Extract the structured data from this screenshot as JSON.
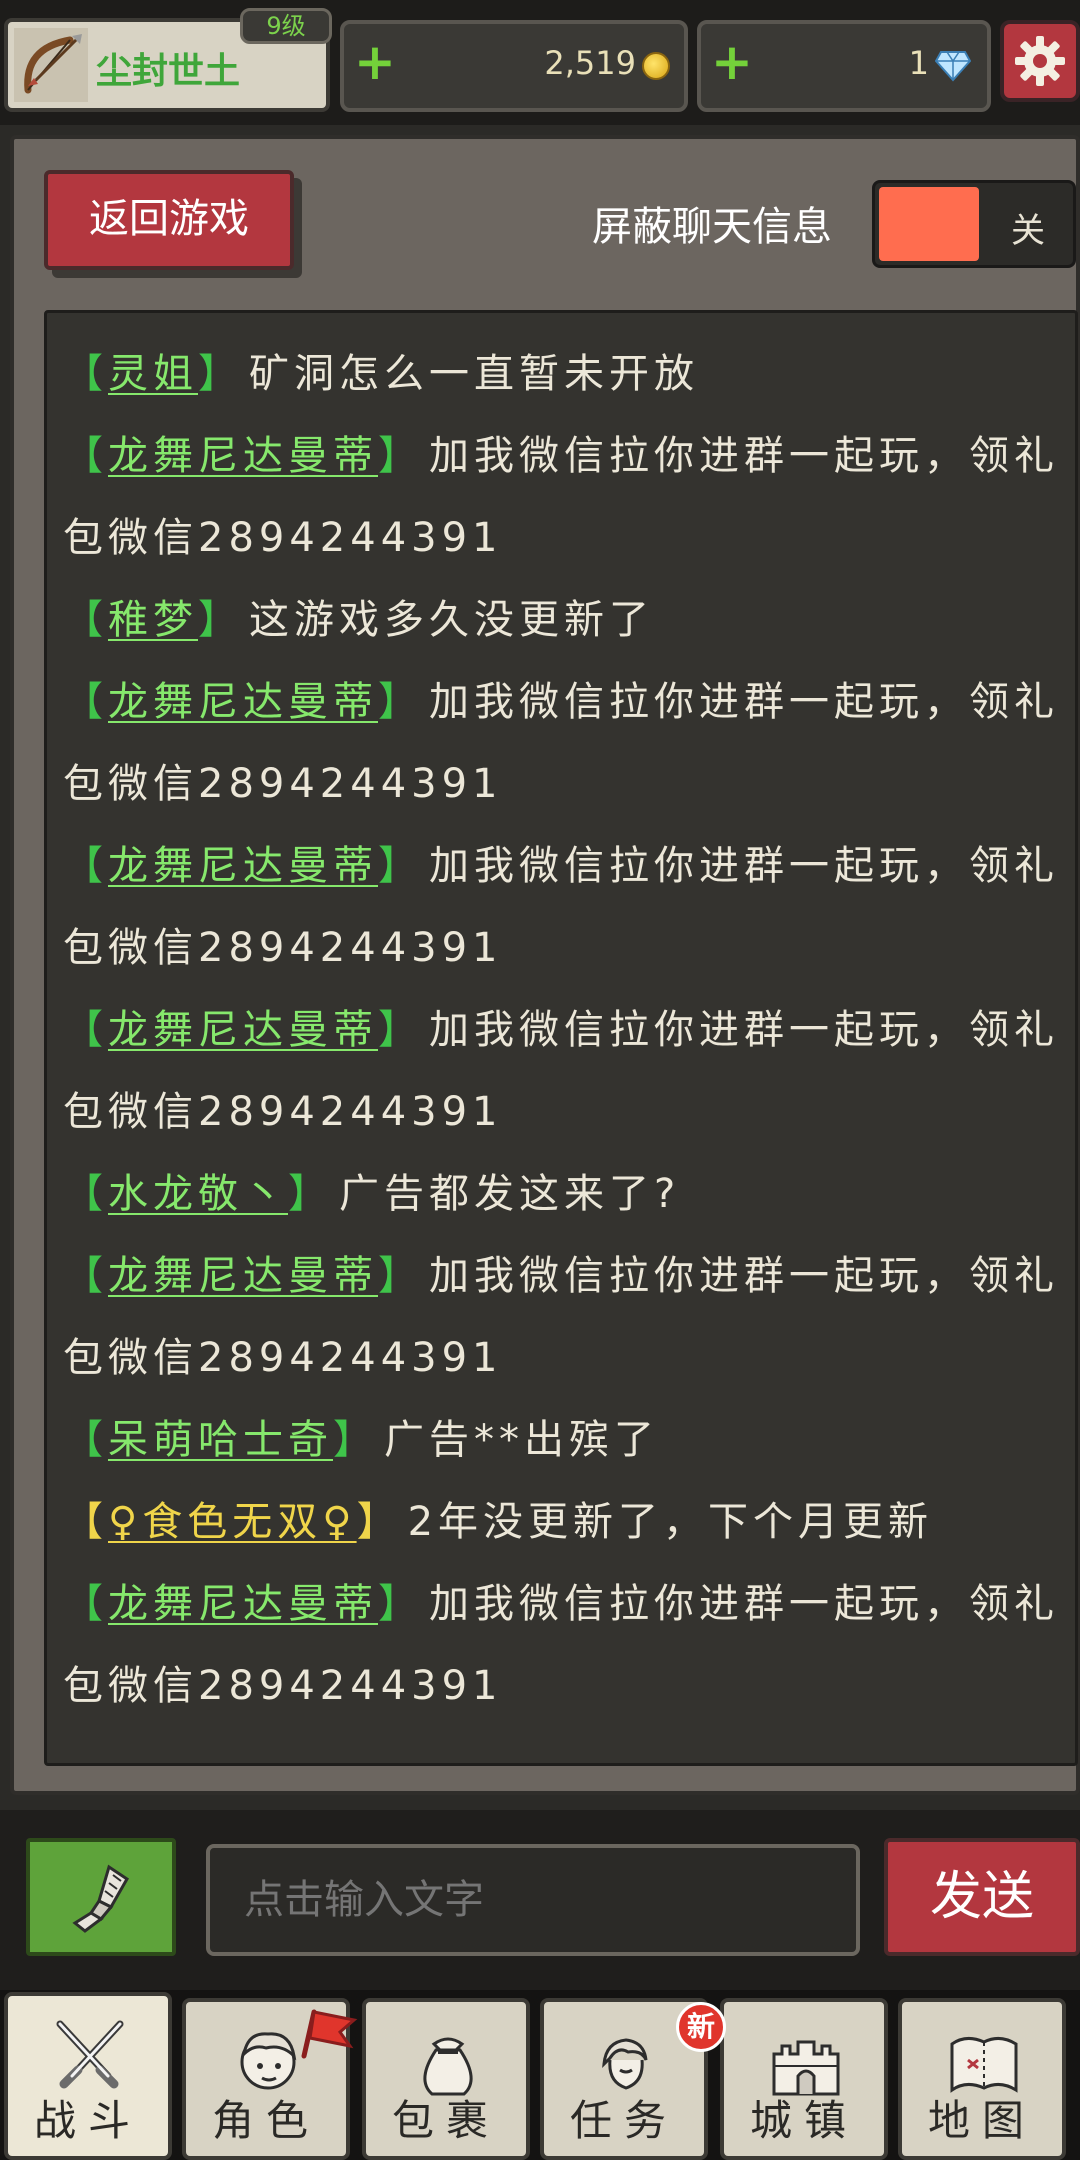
{
  "player": {
    "name": "尘封世土",
    "level": "9级"
  },
  "resources": {
    "gold": "2,519",
    "gems": "1"
  },
  "chat": {
    "back_label": "返回游戏",
    "block_label": "屏蔽聊天信息",
    "toggle_state": "关",
    "messages": [
      {
        "name": "灵姐",
        "text": "矿洞怎么一直暂未开放",
        "color": "green"
      },
      {
        "name": "龙舞尼达曼蒂",
        "text": "加我微信拉你进群一起玩，领礼包微信2894244391",
        "color": "green"
      },
      {
        "name": "稚梦",
        "text": "这游戏多久没更新了",
        "color": "green"
      },
      {
        "name": "龙舞尼达曼蒂",
        "text": "加我微信拉你进群一起玩，领礼包微信2894244391",
        "color": "green"
      },
      {
        "name": "龙舞尼达曼蒂",
        "text": "加我微信拉你进群一起玩，领礼包微信2894244391",
        "color": "green"
      },
      {
        "name": "龙舞尼达曼蒂",
        "text": "加我微信拉你进群一起玩，领礼包微信2894244391",
        "color": "green"
      },
      {
        "name": "水龙敬丶",
        "text": "广告都发这来了?",
        "color": "green"
      },
      {
        "name": "龙舞尼达曼蒂",
        "text": "加我微信拉你进群一起玩，领礼包微信2894244391",
        "color": "green"
      },
      {
        "name": "呆萌哈士奇",
        "text": "广告**出殡了",
        "color": "green"
      },
      {
        "name": "♀食色无双♀",
        "text": "2年没更新了，下个月更新",
        "color": "gold"
      },
      {
        "name": "龙舞尼达曼蒂",
        "text": "加我微信拉你进群一起玩，领礼包微信2894244391",
        "color": "green"
      }
    ]
  },
  "input": {
    "placeholder": "点击输入文字",
    "send_label": "发送"
  },
  "nav": {
    "tabs": [
      {
        "label": "战斗",
        "icon": "crossed-swords-icon"
      },
      {
        "label": "角色",
        "icon": "character-icon"
      },
      {
        "label": "包裹",
        "icon": "bag-icon"
      },
      {
        "label": "任务",
        "icon": "quest-icon"
      },
      {
        "label": "城镇",
        "icon": "castle-icon"
      },
      {
        "label": "地图",
        "icon": "map-icon"
      }
    ],
    "new_badge": "新"
  },
  "colors": {
    "accent_red": "#b3373f",
    "toggle_on": "#ff6d4f",
    "name_green": "#86e86c",
    "name_gold": "#f0d54a"
  }
}
